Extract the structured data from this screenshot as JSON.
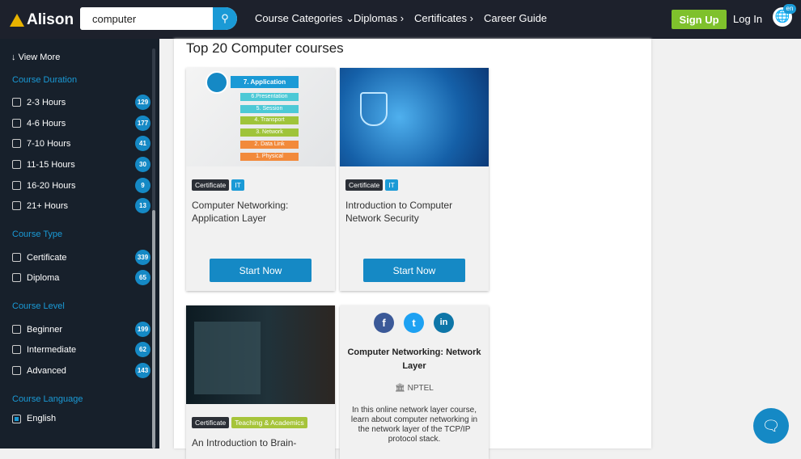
{
  "header": {
    "logo": "Alison",
    "search_value": "computer",
    "nav": [
      "Course Categories",
      "Diplomas",
      "Certificates",
      "Career Guide"
    ],
    "signup": "Sign Up",
    "login": "Log In",
    "lang": "en"
  },
  "sidebar": {
    "view_more": "View More",
    "sections": [
      {
        "title": "Course Duration",
        "items": [
          {
            "label": "2-3 Hours",
            "count": "129"
          },
          {
            "label": "4-6 Hours",
            "count": "177"
          },
          {
            "label": "7-10 Hours",
            "count": "41"
          },
          {
            "label": "11-15 Hours",
            "count": "30"
          },
          {
            "label": "16-20 Hours",
            "count": "9"
          },
          {
            "label": "21+ Hours",
            "count": "13"
          }
        ]
      },
      {
        "title": "Course Type",
        "items": [
          {
            "label": "Certificate",
            "count": "339"
          },
          {
            "label": "Diploma",
            "count": "65"
          }
        ]
      },
      {
        "title": "Course Level",
        "items": [
          {
            "label": "Beginner",
            "count": "199"
          },
          {
            "label": "Intermediate",
            "count": "62"
          },
          {
            "label": "Advanced",
            "count": "143"
          }
        ]
      },
      {
        "title": "Course Language",
        "items": [
          {
            "label": "English",
            "checked": true
          }
        ]
      }
    ]
  },
  "main": {
    "title": "Top 20 Computer courses",
    "osi_layers": [
      "7. Application",
      "6.Presentation",
      "5. Session",
      "4. Transport",
      "3. Network",
      "2. Data Link",
      "1. Physical"
    ],
    "cards": [
      {
        "tags": [
          "Certificate",
          "IT"
        ],
        "title": "Computer Networking: Application Layer",
        "button": "Start Now"
      },
      {
        "tags": [
          "Certificate",
          "IT"
        ],
        "title": "Introduction to Computer Network Security",
        "button": "Start Now"
      },
      {
        "tags": [
          "Certificate",
          "Teaching & Academics"
        ],
        "title": "An Introduction to Brain-"
      }
    ],
    "hover_card": {
      "title": "Computer Networking: Network Layer",
      "provider": "NPTEL",
      "description": "In this online network layer course, learn about computer networking in the network layer of the TCP/IP protocol stack."
    }
  },
  "colors": {
    "accent": "#1589c5",
    "signup": "#7fc12c",
    "header": "#1d212c",
    "sidebar": "#17202b"
  }
}
